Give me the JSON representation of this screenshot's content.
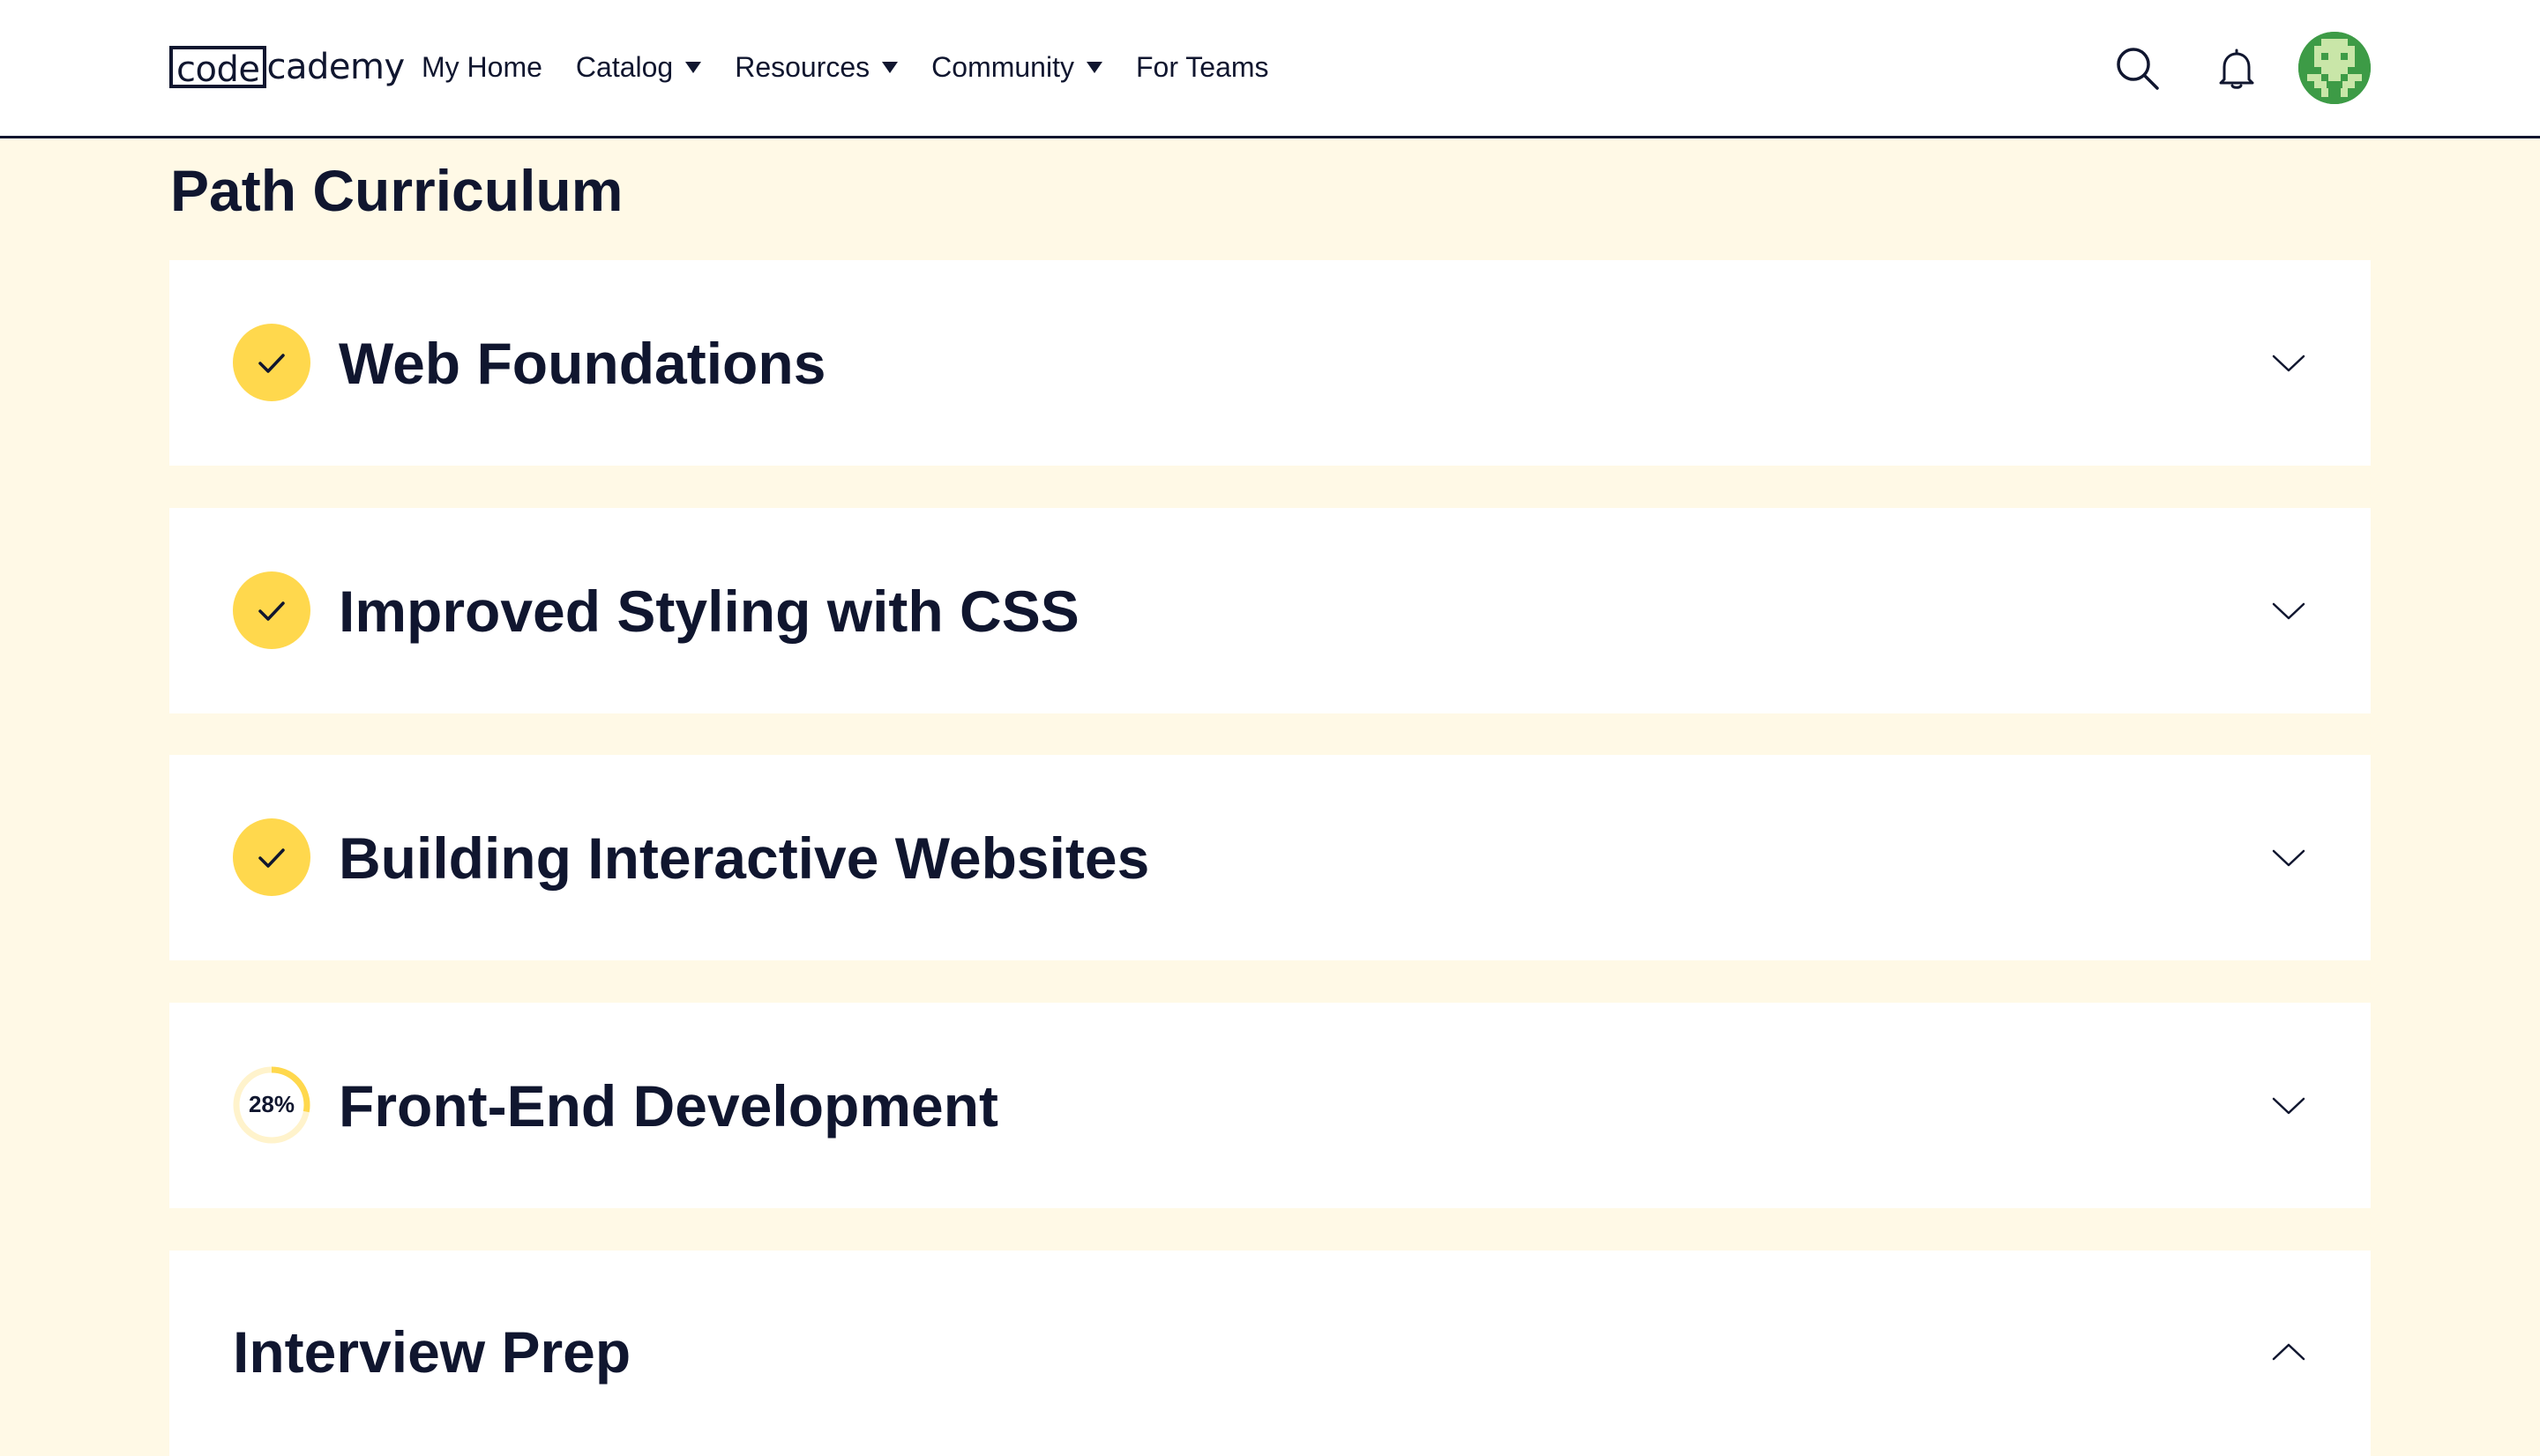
{
  "header": {
    "logo_boxed": "code",
    "logo_rest": "cademy",
    "nav": [
      {
        "label": "My Home",
        "dropdown": false
      },
      {
        "label": "Catalog",
        "dropdown": true
      },
      {
        "label": "Resources",
        "dropdown": true
      },
      {
        "label": "Community",
        "dropdown": true
      },
      {
        "label": "For Teams",
        "dropdown": false
      }
    ],
    "icons": [
      "search-icon",
      "bell-icon"
    ],
    "avatar_color": "#3d9b46"
  },
  "main": {
    "title": "Path Curriculum",
    "modules": [
      {
        "title": "Web Foundations",
        "status": "complete",
        "expanded": false
      },
      {
        "title": "Improved Styling with CSS",
        "status": "complete",
        "expanded": false
      },
      {
        "title": "Building Interactive Websites",
        "status": "complete",
        "expanded": false
      },
      {
        "title": "Front-End Development",
        "status": "in-progress",
        "progress_label": "28%",
        "progress": 0.28,
        "expanded": false
      },
      {
        "title": "Interview Prep",
        "status": "none",
        "expanded": true
      }
    ]
  },
  "colors": {
    "navy": "#10162f",
    "page_background": "#fff9e6",
    "complete_yellow": "#ffd84d",
    "progress_track": "#fff3cc"
  }
}
